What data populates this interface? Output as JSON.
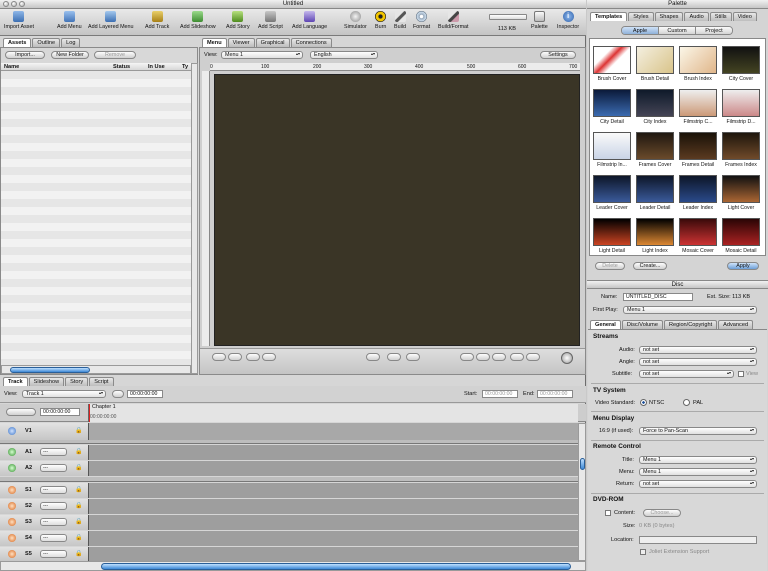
{
  "window": {
    "title": "Untitled"
  },
  "toolbar": {
    "items": [
      {
        "label": "Import Asset",
        "icon": "import-asset-icon"
      },
      {
        "label": "Add Menu",
        "icon": "add-menu-icon"
      },
      {
        "label": "Add Layered Menu",
        "icon": "add-layered-menu-icon"
      },
      {
        "label": "Add Track",
        "icon": "add-track-icon"
      },
      {
        "label": "Add Slideshow",
        "icon": "add-slideshow-icon"
      },
      {
        "label": "Add Story",
        "icon": "add-story-icon"
      },
      {
        "label": "Add Script",
        "icon": "add-script-icon"
      },
      {
        "label": "Add Language",
        "icon": "add-language-icon"
      },
      {
        "label": "Simulator",
        "icon": "simulator-icon"
      },
      {
        "label": "Burn",
        "icon": "burn-icon"
      },
      {
        "label": "Build",
        "icon": "build-icon"
      },
      {
        "label": "Format",
        "icon": "format-icon"
      },
      {
        "label": "Build/Format",
        "icon": "build-format-icon"
      },
      {
        "label": "Palette",
        "icon": "palette-icon"
      },
      {
        "label": "Inspector",
        "icon": "inspector-icon"
      }
    ],
    "disk_meter": "113 KB"
  },
  "assets": {
    "tabs": [
      "Assets",
      "Outline",
      "Log"
    ],
    "import_label": "Import...",
    "new_folder_label": "New Folder",
    "remove_label": "Remove",
    "columns": [
      "Name",
      "Status",
      "In Use",
      "Ty"
    ]
  },
  "editor": {
    "tabs": [
      "Menu",
      "Viewer",
      "Graphical",
      "Connections"
    ],
    "view_label": "View:",
    "view_value": "Menu 1",
    "language_value": "English",
    "settings_label": "Settings",
    "ruler_ticks": [
      "0",
      "100",
      "200",
      "300",
      "400",
      "500",
      "600",
      "700"
    ]
  },
  "timeline": {
    "tabs": [
      "Track",
      "Slideshow",
      "Story",
      "Script"
    ],
    "view_label": "View:",
    "view_value": "Track 1",
    "timecode": "00:00:00:00",
    "timecode_small": "00:00:00:00",
    "chapter_label": "Chapter 1",
    "start_label": "Start:",
    "start_value": "00:00:00:00",
    "end_label": "End:",
    "end_value": "00:00:00:00",
    "video_track": "V1",
    "audio_tracks": [
      "A1",
      "A2"
    ],
    "subtitle_tracks": [
      "S1",
      "S2",
      "S3",
      "S4",
      "S5"
    ],
    "track_popup": "---"
  },
  "palette": {
    "title": "Palette",
    "tabs": [
      "Templates",
      "Styles",
      "Shapes",
      "Audio",
      "Stills",
      "Video"
    ],
    "subtabs": [
      "Apple",
      "Custom",
      "Project"
    ],
    "templates": [
      "Brush Cover",
      "Brush Detail",
      "Brush Index",
      "City Cover",
      "City Detail",
      "City Index",
      "Filmstrip C...",
      "Filmstrip D...",
      "Filmstrip In...",
      "Frames Cover",
      "Frames Detail",
      "Frames Index",
      "Leader Cover",
      "Leader Detail",
      "Leader Index",
      "Light Cover",
      "Light Detail",
      "Light Index",
      "Mosaic Cover",
      "Mosaic Detail"
    ],
    "delete_label": "Delete",
    "create_label": "Create...",
    "apply_label": "Apply"
  },
  "disc": {
    "title": "Disc",
    "name_label": "Name:",
    "name_value": "UNTITLED_DISC",
    "est_size": "Est. Size: 113 KB",
    "first_play_label": "First Play:",
    "first_play_value": "Menu 1",
    "tabs": [
      "General",
      "Disc/Volume",
      "Region/Copyright",
      "Advanced"
    ],
    "streams": {
      "heading": "Streams",
      "audio_label": "Audio:",
      "audio_value": "not set",
      "angle_label": "Angle:",
      "angle_value": "not set",
      "subtitle_label": "Subtitle:",
      "subtitle_value": "not set",
      "view_label": "View"
    },
    "tv": {
      "heading": "TV System",
      "label": "Video Standard:",
      "ntsc": "NTSC",
      "pal": "PAL"
    },
    "menu_display": {
      "heading": "Menu Display",
      "label": "16:9 (if used):",
      "value": "Force to Pan-Scan"
    },
    "remote": {
      "heading": "Remote Control",
      "title_label": "Title:",
      "title_value": "Menu 1",
      "menu_label": "Menu:",
      "menu_value": "Menu 1",
      "return_label": "Return:",
      "return_value": "not set"
    },
    "dvdrom": {
      "heading": "DVD-ROM",
      "content_label": "Content:",
      "choose_label": "Choose...",
      "size_label": "Size:",
      "size_value": "0 KB (0 bytes)",
      "location_label": "Location:",
      "joliet_label": "Joliet Extension Support"
    }
  },
  "colors": {
    "canvas": "#3a3526",
    "accent": "#3d88d6"
  }
}
